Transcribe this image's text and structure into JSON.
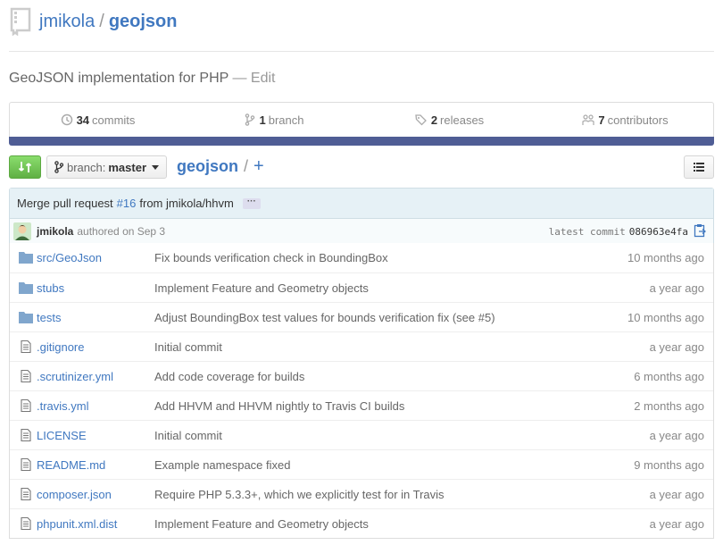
{
  "header": {
    "owner": "jmikola",
    "separator": "/",
    "repo": "geojson"
  },
  "description": {
    "text": "GeoJSON implementation for PHP",
    "edit": "— Edit"
  },
  "summary": [
    {
      "count": "34",
      "label": "commits",
      "icon": "history-icon"
    },
    {
      "count": "1",
      "label": "branch",
      "icon": "branch-icon"
    },
    {
      "count": "2",
      "label": "releases",
      "icon": "tag-icon"
    },
    {
      "count": "7",
      "label": "contributors",
      "icon": "organization-icon"
    }
  ],
  "colors": {
    "language_bar": "#4f5d95",
    "compare_green": "#60b044",
    "link": "#4078c0"
  },
  "branch_selector": {
    "label": "branch:",
    "value": "master"
  },
  "breadcrumb": {
    "root": "geojson",
    "slash": "/",
    "add": "+"
  },
  "commit": {
    "message_prefix": "Merge pull request",
    "pr": "#16",
    "message_suffix": "from jmikola/hhvm",
    "ellipsis": "···",
    "author": "jmikola",
    "authored": "authored on Sep 3",
    "latest_label": "latest commit",
    "sha": "086963e4fa"
  },
  "files": [
    {
      "type": "dir",
      "name_prefix": "src/",
      "name": "GeoJson",
      "message": "Fix bounds verification check in BoundingBox",
      "age": "10 months ago"
    },
    {
      "type": "dir",
      "name_prefix": "",
      "name": "stubs",
      "message": "Implement Feature and Geometry objects",
      "age": "a year ago"
    },
    {
      "type": "dir",
      "name_prefix": "",
      "name": "tests",
      "message": "Adjust BoundingBox test values for bounds verification fix (see #5)",
      "age": "10 months ago"
    },
    {
      "type": "file",
      "name_prefix": "",
      "name": ".gitignore",
      "message": "Initial commit",
      "age": "a year ago"
    },
    {
      "type": "file",
      "name_prefix": "",
      "name": ".scrutinizer.yml",
      "message": "Add code coverage for builds",
      "age": "6 months ago"
    },
    {
      "type": "file",
      "name_prefix": "",
      "name": ".travis.yml",
      "message": "Add HHVM and HHVM nightly to Travis CI builds",
      "age": "2 months ago"
    },
    {
      "type": "file",
      "name_prefix": "",
      "name": "LICENSE",
      "message": "Initial commit",
      "age": "a year ago"
    },
    {
      "type": "file",
      "name_prefix": "",
      "name": "README.md",
      "message": "Example namespace fixed",
      "age": "9 months ago"
    },
    {
      "type": "file",
      "name_prefix": "",
      "name": "composer.json",
      "message": "Require PHP 5.3.3+, which we explicitly test for in Travis",
      "age": "a year ago"
    },
    {
      "type": "file",
      "name_prefix": "",
      "name": "phpunit.xml.dist",
      "message": "Implement Feature and Geometry objects",
      "age": "a year ago"
    }
  ]
}
